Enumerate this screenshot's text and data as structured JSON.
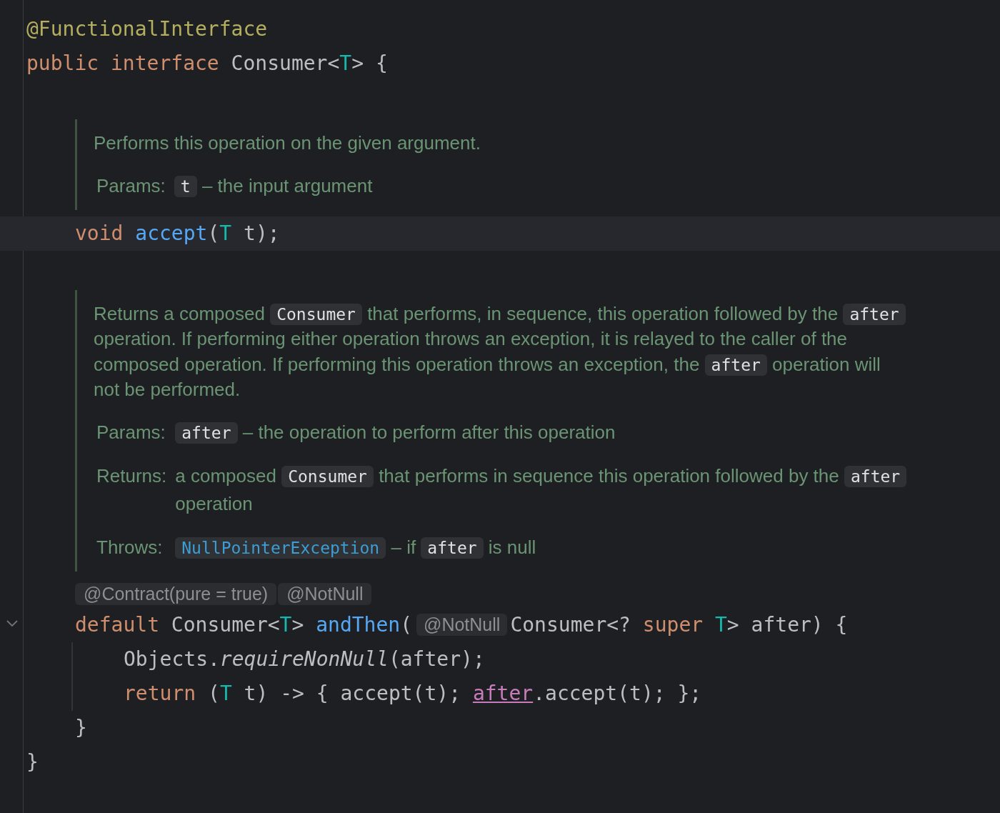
{
  "editor": {
    "lines": [
      {
        "kind": "code",
        "tokens": [
          {
            "kind": "annotation",
            "text": "@FunctionalInterface"
          }
        ]
      },
      {
        "kind": "code",
        "tokens": [
          {
            "kind": "keyword",
            "text": "public"
          },
          {
            "kind": "keyword",
            "text": " interface"
          },
          {
            "kind": "plain",
            "text": " Consumer<"
          },
          {
            "kind": "typeparam",
            "text": "T"
          },
          {
            "kind": "plain",
            "text": "> {"
          }
        ],
        "children": [
          {
            "kind": "doc",
            "description": [
              {
                "kind": "text",
                "text": "Performs this operation on the given argument."
              }
            ],
            "tags": [
              {
                "label": "Params:",
                "content": [
                  {
                    "kind": "code",
                    "text": "t"
                  },
                  {
                    "kind": "text",
                    "text": " – the input argument"
                  }
                ]
              }
            ]
          },
          {
            "kind": "code",
            "current": true,
            "tokens": [
              {
                "kind": "keyword",
                "text": "void"
              },
              {
                "kind": "method",
                "text": " accept"
              },
              {
                "kind": "plain",
                "text": "("
              },
              {
                "kind": "typeparam",
                "text": "T"
              },
              {
                "kind": "plain",
                "text": " t);"
              }
            ]
          },
          {
            "kind": "doc",
            "description": [
              {
                "kind": "text",
                "text": "Returns a composed "
              },
              {
                "kind": "code",
                "text": "Consumer"
              },
              {
                "kind": "text",
                "text": " that performs, in sequence, this operation followed by the "
              },
              {
                "kind": "code",
                "text": "after"
              },
              {
                "kind": "text",
                "text": " operation. If performing either operation throws an exception, it is relayed to the caller of the composed operation. If performing this operation throws an exception, the "
              },
              {
                "kind": "code",
                "text": "after"
              },
              {
                "kind": "text",
                "text": " operation will not be performed."
              }
            ],
            "tags": [
              {
                "label": "Params:",
                "content": [
                  {
                    "kind": "code",
                    "text": "after"
                  },
                  {
                    "kind": "text",
                    "text": " – the operation to perform after this operation"
                  }
                ]
              },
              {
                "label": "Returns:",
                "content": [
                  {
                    "kind": "text",
                    "text": "a composed "
                  },
                  {
                    "kind": "code",
                    "text": "Consumer"
                  },
                  {
                    "kind": "text",
                    "text": " that performs in sequence this operation followed by the "
                  },
                  {
                    "kind": "code",
                    "text": "after"
                  },
                  {
                    "kind": "text",
                    "text": " operation"
                  }
                ]
              },
              {
                "label": "Throws:",
                "content": [
                  {
                    "kind": "link",
                    "text": "NullPointerException"
                  },
                  {
                    "kind": "text",
                    "text": " – if "
                  },
                  {
                    "kind": "code",
                    "text": "after"
                  },
                  {
                    "kind": "text",
                    "text": " is null"
                  }
                ]
              }
            ]
          },
          {
            "kind": "hints",
            "items": [
              "@Contract(pure = true)",
              "@NotNull"
            ]
          },
          {
            "kind": "code",
            "fold": true,
            "tokens": [
              {
                "kind": "keyword",
                "text": "default"
              },
              {
                "kind": "plain",
                "text": " Consumer<"
              },
              {
                "kind": "typeparam",
                "text": "T"
              },
              {
                "kind": "plain",
                "text": ">"
              },
              {
                "kind": "method",
                "text": " andThen"
              },
              {
                "kind": "plain",
                "text": "("
              },
              {
                "kind": "hint",
                "text": "@NotNull"
              },
              {
                "kind": "plain",
                "text": "Consumer<? "
              },
              {
                "kind": "keyword",
                "text": "super"
              },
              {
                "kind": "typeparam",
                "text": " T"
              },
              {
                "kind": "plain",
                "text": "> after) {"
              }
            ],
            "children": [
              {
                "kind": "code",
                "tokens": [
                  {
                    "kind": "plain",
                    "text": "Objects."
                  },
                  {
                    "kind": "italic",
                    "text": "requireNonNull"
                  },
                  {
                    "kind": "plain",
                    "text": "(after);"
                  }
                ]
              },
              {
                "kind": "code",
                "tokens": [
                  {
                    "kind": "keyword",
                    "text": "return"
                  },
                  {
                    "kind": "plain",
                    "text": " ("
                  },
                  {
                    "kind": "typeparam",
                    "text": "T"
                  },
                  {
                    "kind": "plain",
                    "text": " t) -> { accept(t); "
                  },
                  {
                    "kind": "captured",
                    "text": "after"
                  },
                  {
                    "kind": "plain",
                    "text": ".accept(t); };"
                  }
                ]
              }
            ]
          },
          {
            "kind": "code",
            "tokens": [
              {
                "kind": "plain",
                "text": "}"
              }
            ]
          }
        ]
      },
      {
        "kind": "code",
        "tokens": [
          {
            "kind": "plain",
            "text": "}"
          }
        ]
      }
    ]
  }
}
